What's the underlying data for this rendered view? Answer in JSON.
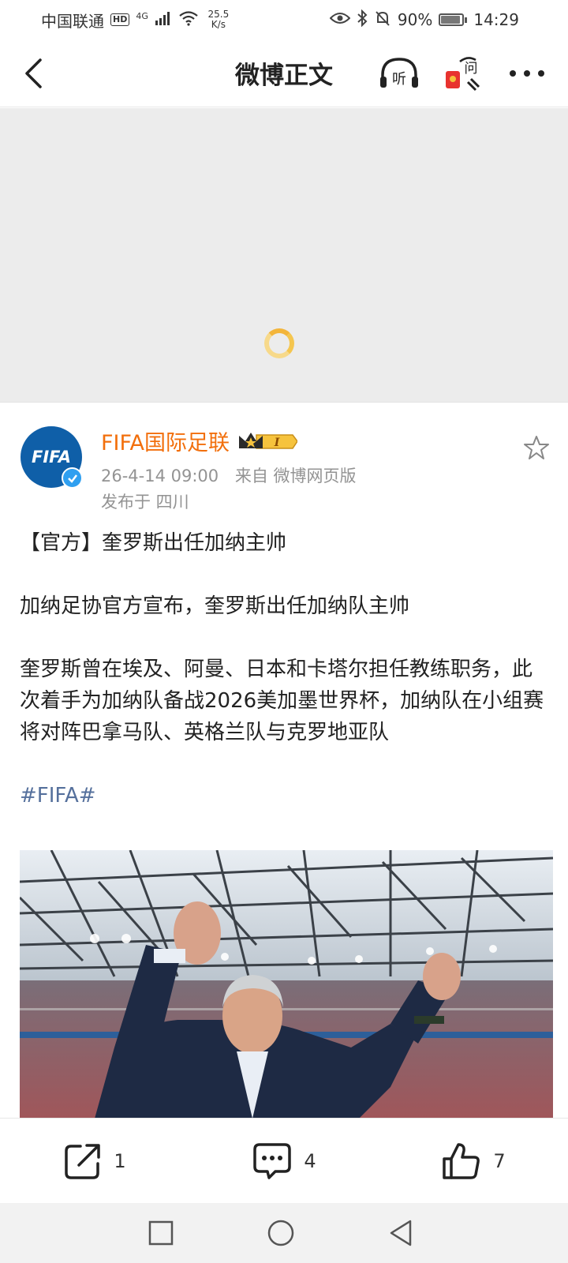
{
  "status_bar": {
    "carrier": "中国联通",
    "hd": "HD",
    "network": "4G",
    "speed_value": "25.5",
    "speed_unit": "K/s",
    "battery": "90%",
    "time": "14:29"
  },
  "title_bar": {
    "title": "微博正文",
    "listen_label": "听",
    "ask_label": "问"
  },
  "post": {
    "avatar_text": "FIFA",
    "author": "FIFA国际足联",
    "rank_badge": "I",
    "date": "26-4-14 09:00",
    "source": "来自 微博网页版",
    "location": "发布于 四川",
    "paragraphs": [
      "【官方】奎罗斯出任加纳主帅",
      "加纳足协官方宣布，奎罗斯出任加纳队主帅",
      "奎罗斯曾在埃及、阿曼、日本和卡塔尔担任教练职务，此次着手为加纳队备战2026美加墨世界杯，加纳队在小组赛将对阵巴拿马队、英格兰队与克罗地亚队"
    ],
    "hashtag": "#FIFA#"
  },
  "actions": {
    "share_count": "1",
    "comment_count": "4",
    "like_count": "7"
  },
  "colors": {
    "author": "#f26f0c",
    "hashtag": "#55709c",
    "meta": "#939393",
    "loading": "#f3b53a"
  },
  "icons": [
    "back-arrow-icon",
    "headphones-icon",
    "ask-icon",
    "more-icon",
    "star-icon",
    "share-icon",
    "comment-icon",
    "like-icon",
    "square-nav-icon",
    "circle-nav-icon",
    "triangle-nav-icon"
  ]
}
